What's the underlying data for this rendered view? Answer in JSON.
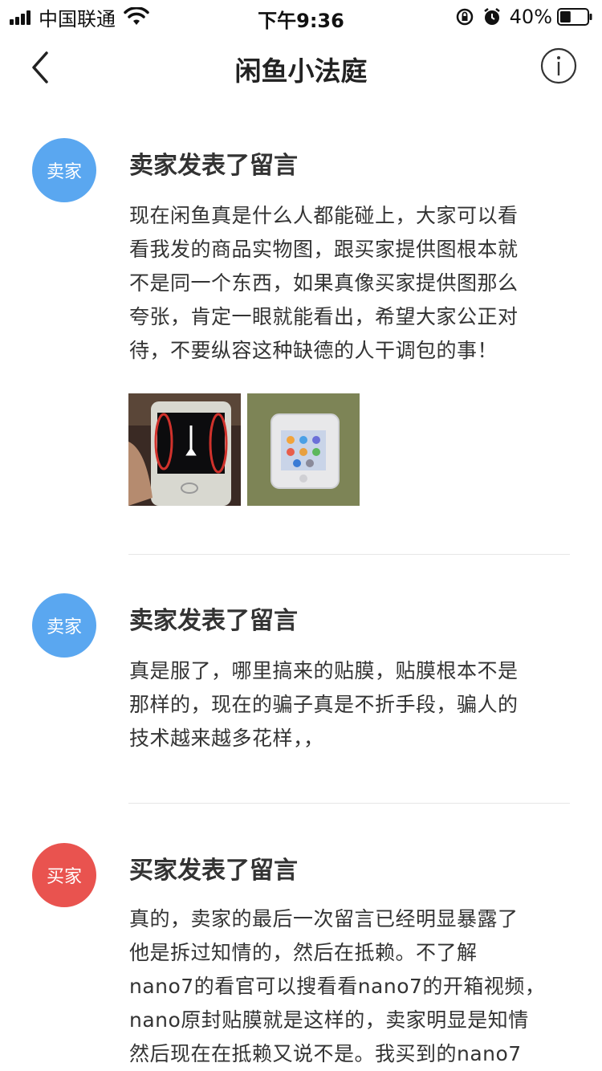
{
  "status_bar": {
    "carrier": "中国联通",
    "time": "下午9:36",
    "battery": "40%",
    "battery_level": 0.4
  },
  "nav": {
    "title": "闲鱼小法庭",
    "back_icon": "chevron-left-icon",
    "info_icon": "info-circle-icon"
  },
  "messages": [
    {
      "role": "卖家",
      "role_color": "#5AA7F0",
      "title": "卖家发表了留言",
      "lines": [
        "现在闲鱼真是什么人都能碰上，大家可以看",
        "看我发的商品实物图，跟买家提供图根本就",
        "不是同一个东西，如果真像买家提供图那么",
        "夸张，肯定一眼就能看出，希望大家公正对",
        "待，不要纵容这种缺德的人干调包的事！"
      ]
    },
    {
      "role": "卖家",
      "role_color": "#5AA7F0",
      "title": "卖家发表了留言",
      "lines": [
        "真是服了，哪里搞来的贴膜，贴膜根本不是",
        "那样的，现在的骗子真是不折手段，骗人的",
        "技术越来越多花样，，"
      ]
    },
    {
      "role": "买家",
      "role_color": "#E9534F",
      "title": "买家发表了留言",
      "lines": [
        "真的，卖家的最后一次留言已经明显暴露了",
        "他是拆过知情的，然后在抵赖。不了解",
        "nano7的看官可以搜看看nano7的开箱视频，",
        "nano原封贴膜就是这样的，卖家明显是知情",
        "然后现在在抵赖又说不是。我买到的nano7"
      ]
    }
  ]
}
